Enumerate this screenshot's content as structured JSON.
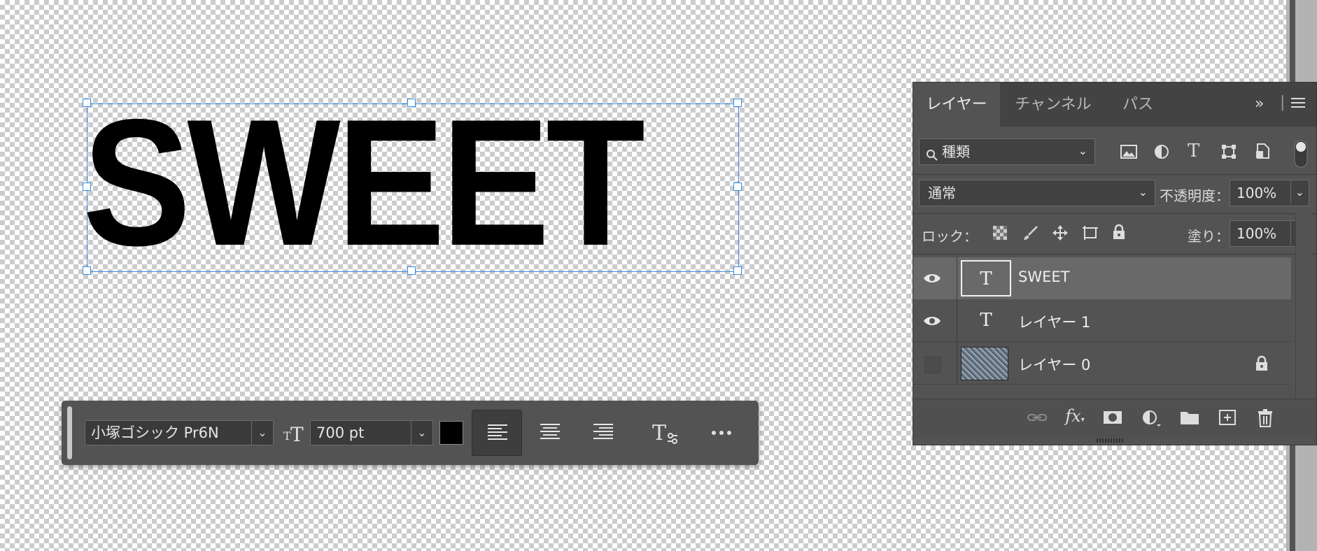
{
  "canvas": {
    "text": "SWEET",
    "text_color": "#000000",
    "selection_color": "#2f8de4"
  },
  "taskbar": {
    "font_family": "小塚ゴシック Pr6N",
    "font_size": "700 pt",
    "text_color": "#000000",
    "alignment": "left",
    "icons": [
      "font-size-icon",
      "align-left-icon",
      "align-center-icon",
      "align-right-icon",
      "text-options-icon",
      "more-icon"
    ]
  },
  "layers_panel": {
    "tabs": [
      {
        "label": "レイヤー",
        "active": true
      },
      {
        "label": "チャンネル",
        "active": false
      },
      {
        "label": "パス",
        "active": false
      }
    ],
    "filter": {
      "label": "種類"
    },
    "blend_mode": "通常",
    "opacity_label": "不透明度：",
    "opacity_value": "100%",
    "lock_label": "ロック：",
    "fill_label": "塗り：",
    "fill_value": "100%",
    "layers": [
      {
        "name": "SWEET",
        "type": "text",
        "visible": true,
        "selected": true,
        "locked": false
      },
      {
        "name": "レイヤー 1",
        "type": "text",
        "visible": true,
        "selected": false,
        "locked": false
      },
      {
        "name": "レイヤー 0",
        "type": "image",
        "visible": false,
        "selected": false,
        "locked": true
      }
    ],
    "footer_icons": [
      "link-icon",
      "fx-icon",
      "mask-icon",
      "adjustment-icon",
      "folder-icon",
      "new-layer-icon",
      "trash-icon"
    ]
  }
}
